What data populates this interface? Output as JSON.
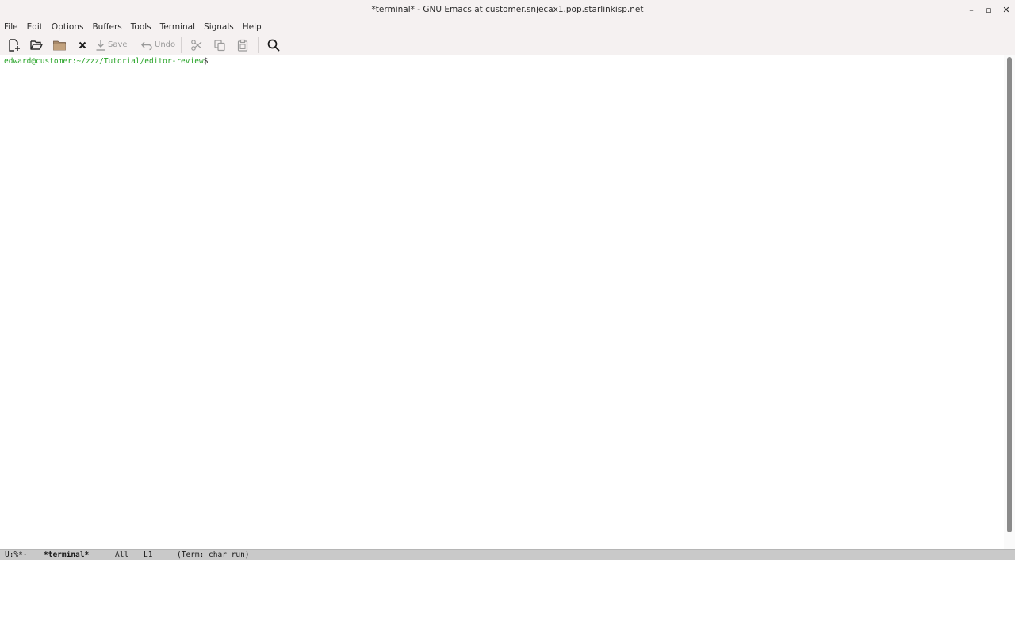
{
  "window": {
    "title": "*terminal* - GNU Emacs at customer.snjecax1.pop.starlinkisp.net",
    "controls": {
      "minimize": "–",
      "maximize": "▫",
      "close": "✕"
    }
  },
  "menubar": {
    "items": [
      {
        "label": "File"
      },
      {
        "label": "Edit"
      },
      {
        "label": "Options"
      },
      {
        "label": "Buffers"
      },
      {
        "label": "Tools"
      },
      {
        "label": "Terminal"
      },
      {
        "label": "Signals"
      },
      {
        "label": "Help"
      }
    ]
  },
  "toolbar": {
    "save_label": "Save",
    "undo_label": "Undo",
    "icons": [
      "new-file-icon",
      "open-folder-icon",
      "dired-folder-icon",
      "close-buffer-icon",
      "save-icon",
      "undo-icon",
      "cut-icon",
      "copy-icon",
      "paste-icon",
      "search-icon"
    ]
  },
  "buffer": {
    "prompt_user_path": "edward@customer:~/zzz/Tutorial/editor-review",
    "prompt_symbol": "$"
  },
  "modeline": {
    "status": "U:%*-",
    "buffer_name": "*terminal*",
    "position": "All",
    "line": "L1",
    "mode": "(Term: char run)"
  },
  "colors": {
    "chrome_bg": "#f5f1f1",
    "prompt_green": "#26a326",
    "modeline_bg": "#c9c9c9"
  }
}
